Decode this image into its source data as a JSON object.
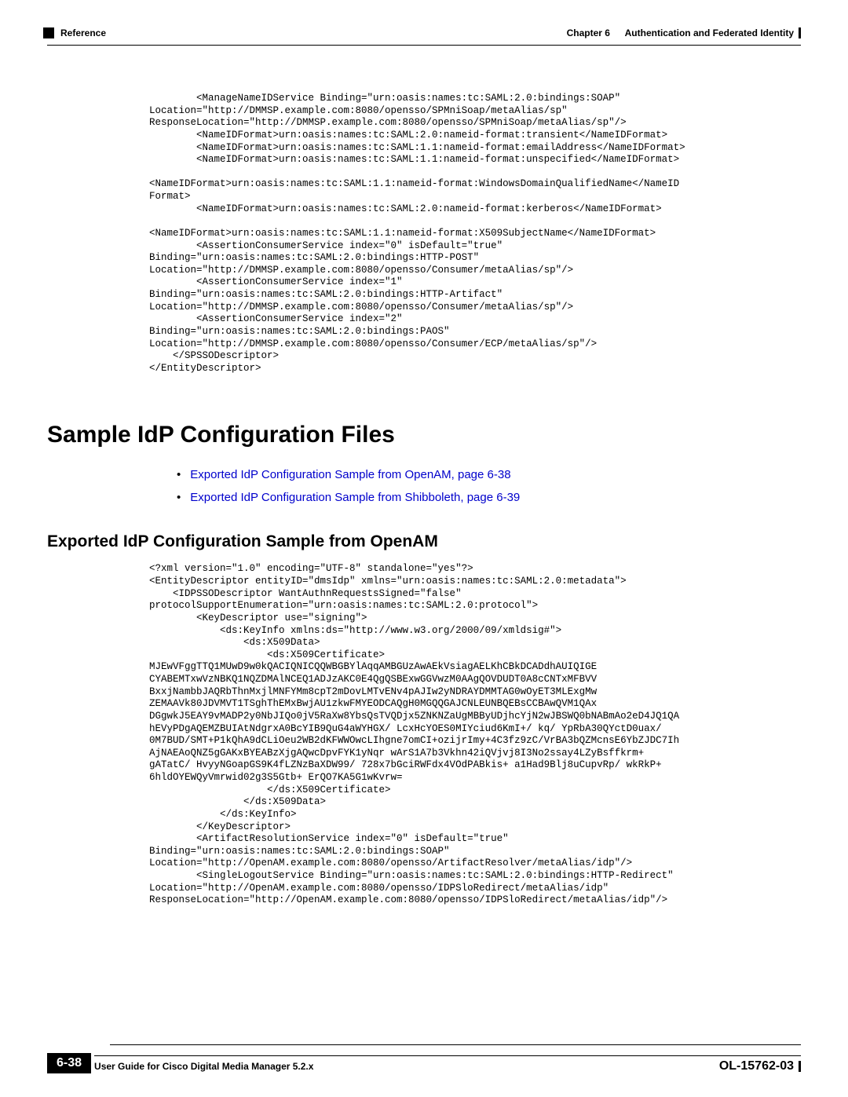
{
  "header": {
    "left": "Reference",
    "chapter_label": "Chapter 6",
    "chapter_title": "Authentication and Federated Identity"
  },
  "code_block_1": "        <ManageNameIDService Binding=\"urn:oasis:names:tc:SAML:2.0:bindings:SOAP\" \nLocation=\"http://DMMSP.example.com:8080/opensso/SPMniSoap/metaAlias/sp\" \nResponseLocation=\"http://DMMSP.example.com:8080/opensso/SPMniSoap/metaAlias/sp\"/>\n        <NameIDFormat>urn:oasis:names:tc:SAML:2.0:nameid-format:transient</NameIDFormat>\n        <NameIDFormat>urn:oasis:names:tc:SAML:1.1:nameid-format:emailAddress</NameIDFormat>\n        <NameIDFormat>urn:oasis:names:tc:SAML:1.1:nameid-format:unspecified</NameIDFormat>\n\n<NameIDFormat>urn:oasis:names:tc:SAML:1.1:nameid-format:WindowsDomainQualifiedName</NameID\nFormat>\n        <NameIDFormat>urn:oasis:names:tc:SAML:2.0:nameid-format:kerberos</NameIDFormat>\n\n<NameIDFormat>urn:oasis:names:tc:SAML:1.1:nameid-format:X509SubjectName</NameIDFormat>\n        <AssertionConsumerService index=\"0\" isDefault=\"true\" \nBinding=\"urn:oasis:names:tc:SAML:2.0:bindings:HTTP-POST\" \nLocation=\"http://DMMSP.example.com:8080/opensso/Consumer/metaAlias/sp\"/>\n        <AssertionConsumerService index=\"1\" \nBinding=\"urn:oasis:names:tc:SAML:2.0:bindings:HTTP-Artifact\" \nLocation=\"http://DMMSP.example.com:8080/opensso/Consumer/metaAlias/sp\"/>\n        <AssertionConsumerService index=\"2\" \nBinding=\"urn:oasis:names:tc:SAML:2.0:bindings:PAOS\" \nLocation=\"http://DMMSP.example.com:8080/opensso/Consumer/ECP/metaAlias/sp\"/>\n    </SPSSODescriptor>\n</EntityDescriptor>",
  "heading1": "Sample IdP Configuration Files",
  "bullets": [
    "Exported IdP Configuration Sample from OpenAM, page 6-38",
    "Exported IdP Configuration Sample from Shibboleth, page 6-39"
  ],
  "heading2": "Exported IdP Configuration Sample from OpenAM",
  "code_block_2": "<?xml version=\"1.0\" encoding=\"UTF-8\" standalone=\"yes\"?>\n<EntityDescriptor entityID=\"dmsIdp\" xmlns=\"urn:oasis:names:tc:SAML:2.0:metadata\">\n    <IDPSSODescriptor WantAuthnRequestsSigned=\"false\" \nprotocolSupportEnumeration=\"urn:oasis:names:tc:SAML:2.0:protocol\">\n        <KeyDescriptor use=\"signing\">\n            <ds:KeyInfo xmlns:ds=\"http://www.w3.org/2000/09/xmldsig#\">\n                <ds:X509Data>\n                    <ds:X509Certificate>\nMJEwVFggTTQ1MUwD9w0kQACIQNICQQWBGBYlAqqAMBGUzAwAEkVsiagAELKhCBkDCADdhAUIQIGE\nCYABEMTxwVzNBKQ1NQZDMAlNCEQ1ADJzAKC0E4QgQSBExwGGVwzM0AAgQOVDUDT0A8cCNTxMFBVV\nBxxjNambbJAQRbThnMxjlMNFYMm8cpT2mDovLMTvENv4pAJIw2yNDRAYDMMTAG0wOyET3MLExgMw\nZEMAAVk80JDVMVT1TSghThEMxBwjAU1zkwFMYEODCAQgH0MGQQGAJCNLEUNBQEBsCCBAwQVM1QAx\nDGgwkJ5EAY9vMADP2y0NbJIQo0jV5RaXw8YbsQsTVQDjx5ZNKNZaUgMBByUDjhcYjN2wJBSWQ0bNABmAo2eD4JQ1QA\nhEVyPDgAQEMZBUIAtNdgrxA0BcYIB9QuG4aWYHGX/ LcxHcYOES0MIYciud6KmI+/ kq/ YpRbA30QYctD0uax/ \n0M7BUD/SMT+P1kQhA9dCLiOeu2WB2dKFWWOwcLIhgne7omCI+ozijrImy+4C3fz9zC/VrBA3bQZMcnsE6YbZJDC7Ih\nAjNAEAoQNZ5gGAKxBYEABzXjgAQwcDpvFYK1yNqr wArS1A7b3Vkhn42iQVjvj8I3No2ssay4LZyBsffkrm+ \ngATatC/ HvyyNGoapGS9K4fLZNzBaXDW99/ 728x7bGciRWFdx4VOdPABkis+ a1Had9Blj8uCupvRp/ wkRkP+ \n6hldOYEWQyVmrwid02g3S5Gtb+ ErQO7KA5G1wKvrw=\n                    </ds:X509Certificate>\n                </ds:X509Data>\n            </ds:KeyInfo>\n        </KeyDescriptor>\n        <ArtifactResolutionService index=\"0\" isDefault=\"true\" \nBinding=\"urn:oasis:names:tc:SAML:2.0:bindings:SOAP\" \nLocation=\"http://OpenAM.example.com:8080/opensso/ArtifactResolver/metaAlias/idp\"/>\n        <SingleLogoutService Binding=\"urn:oasis:names:tc:SAML:2.0:bindings:HTTP-Redirect\" \nLocation=\"http://OpenAM.example.com:8080/opensso/IDPSloRedirect/metaAlias/idp\" \nResponseLocation=\"http://OpenAM.example.com:8080/opensso/IDPSloRedirect/metaAlias/idp\"/>",
  "footer": {
    "title": "User Guide for Cisco Digital Media Manager 5.2.x",
    "page_num": "6-38",
    "doc_id": "OL-15762-03"
  }
}
